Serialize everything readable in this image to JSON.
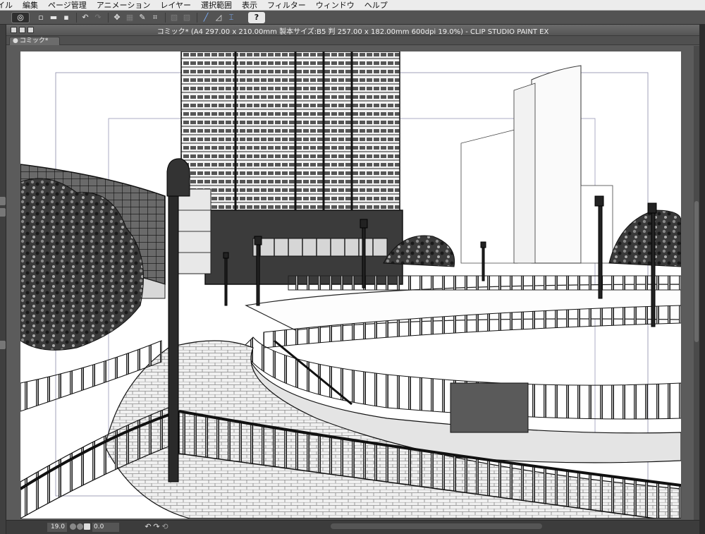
{
  "menu": {
    "items": [
      "イル",
      "編集",
      "ページ管理",
      "アニメーション",
      "レイヤー",
      "選択範囲",
      "表示",
      "フィルター",
      "ウィンドウ",
      "ヘルプ"
    ]
  },
  "toolbar": {
    "buttons": [
      {
        "name": "clip-studio-logo-icon",
        "glyph": "◎"
      },
      {
        "name": "new-file-icon",
        "glyph": "▫"
      },
      {
        "name": "open-folder-icon",
        "glyph": "▬"
      },
      {
        "name": "save-icon",
        "glyph": "▪"
      },
      {
        "name": "undo-icon",
        "glyph": "↶"
      },
      {
        "name": "redo-icon",
        "glyph": "↷"
      },
      {
        "name": "transform-icon",
        "glyph": "✥"
      },
      {
        "name": "clear-icon",
        "glyph": "▦"
      },
      {
        "name": "fill-icon",
        "glyph": "✎"
      },
      {
        "name": "crop-icon",
        "glyph": "⌗"
      },
      {
        "name": "snap-ruler-icon",
        "glyph": "╱"
      },
      {
        "name": "snap-special-ruler-icon",
        "glyph": "◿"
      },
      {
        "name": "snap-grid-icon",
        "glyph": "⌶"
      },
      {
        "name": "help-icon",
        "glyph": "?"
      }
    ]
  },
  "window": {
    "title": "コミック* (A4 297.00 x 210.00mm 製本サイズ:B5 判 257.00 x 182.00mm 600dpi 19.0%)  - CLIP STUDIO PAINT EX",
    "tab_label": "コミック*",
    "tab_dot": "●"
  },
  "status": {
    "zoom": "19.0",
    "angle": "0.0"
  },
  "colors": {
    "ui_dark": "#535353",
    "menu_bg": "#ececec",
    "paper": "#ffffff",
    "accent": "#7fb2ff"
  }
}
